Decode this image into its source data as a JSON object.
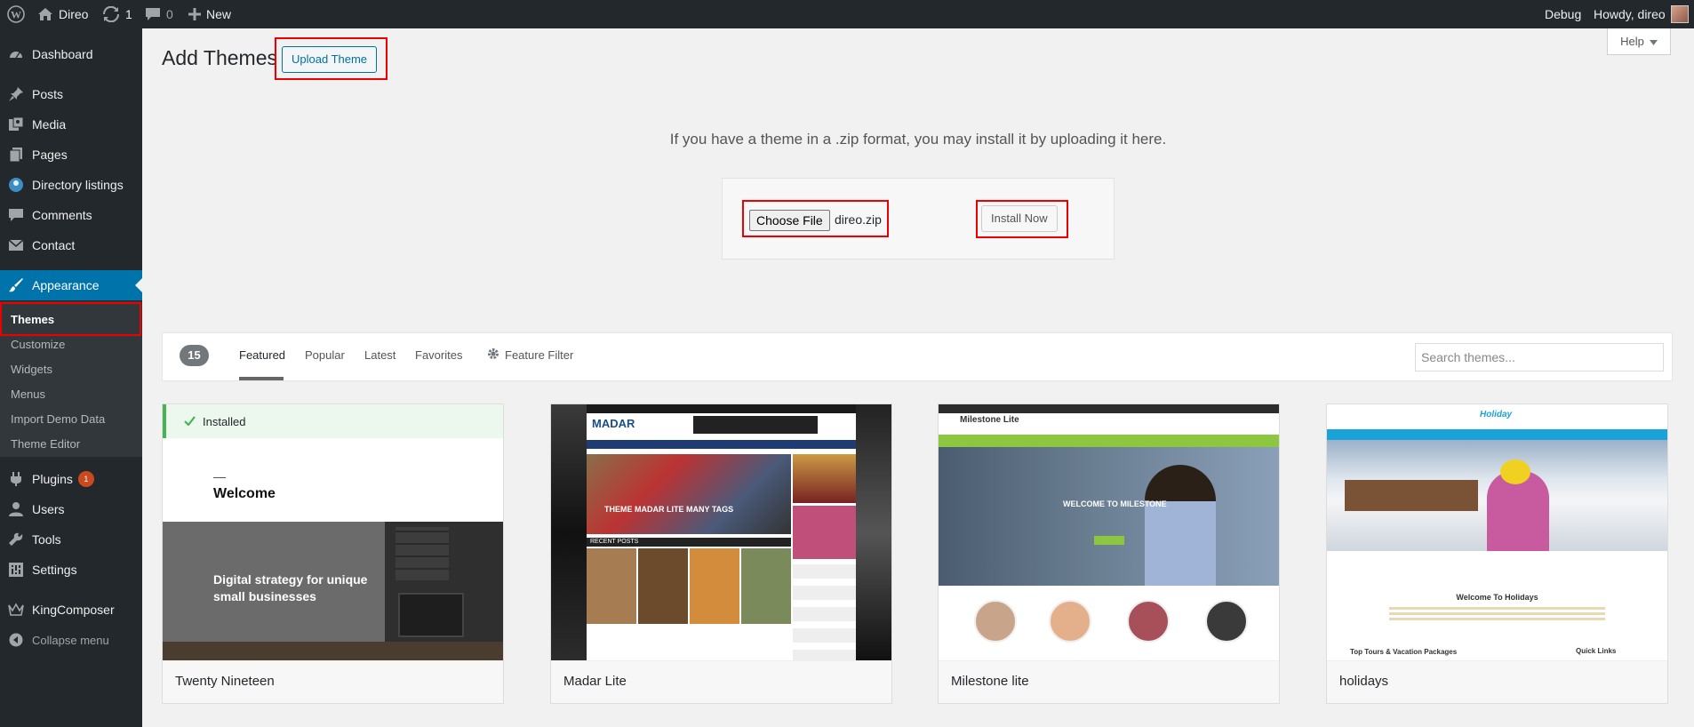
{
  "adminbar": {
    "site_name": "Direo",
    "updates_count": "1",
    "comments_count": "0",
    "new_label": "New",
    "debug_label": "Debug",
    "howdy_label": "Howdy, direo"
  },
  "sidebar": {
    "items": [
      {
        "label": "Dashboard",
        "icon": "dashboard-icon"
      },
      {
        "label": "Posts",
        "icon": "pin-icon"
      },
      {
        "label": "Media",
        "icon": "media-icon"
      },
      {
        "label": "Pages",
        "icon": "pages-icon"
      },
      {
        "label": "Directory listings",
        "icon": "directory-icon"
      },
      {
        "label": "Comments",
        "icon": "comments-icon"
      },
      {
        "label": "Contact",
        "icon": "mail-icon"
      },
      {
        "label": "Appearance",
        "icon": "brush-icon"
      },
      {
        "label": "Plugins",
        "icon": "plugin-icon",
        "badge": "1"
      },
      {
        "label": "Users",
        "icon": "user-icon"
      },
      {
        "label": "Tools",
        "icon": "wrench-icon"
      },
      {
        "label": "Settings",
        "icon": "settings-icon"
      },
      {
        "label": "KingComposer",
        "icon": "crown-icon"
      },
      {
        "label": "Collapse menu",
        "icon": "collapse-icon"
      }
    ],
    "appearance_sub": [
      "Themes",
      "Customize",
      "Widgets",
      "Menus",
      "Import Demo Data",
      "Theme Editor"
    ]
  },
  "header": {
    "title": "Add Themes",
    "upload_label": "Upload Theme",
    "help_label": "Help"
  },
  "upload": {
    "instructions": "If you have a theme in a .zip format, you may install it by uploading it here.",
    "choose_label": "Choose File",
    "file_name": "direo.zip",
    "install_label": "Install Now"
  },
  "filters": {
    "count": "15",
    "tabs": [
      "Featured",
      "Popular",
      "Latest",
      "Favorites"
    ],
    "feature_filter": "Feature Filter",
    "search_placeholder": "Search themes..."
  },
  "themes": [
    {
      "name": "Twenty Nineteen",
      "installed_label": "Installed",
      "preview_heading": "Welcome",
      "preview_tagline": "Digital strategy for unique small businesses"
    },
    {
      "name": "Madar Lite",
      "preview_headline": "THEME MADAR LITE MANY TAGS",
      "preview_section": "RECENT POSTS",
      "preview_logo": "MADAR"
    },
    {
      "name": "Milestone lite",
      "preview_logo": "Milestone Lite",
      "preview_banner": "WELCOME TO MILESTONE"
    },
    {
      "name": "holidays",
      "preview_logo": "Holiday",
      "preview_heading": "Welcome To Holidays",
      "preview_section": "Top Tours & Vacation Packages",
      "preview_side": "Quick Links"
    }
  ],
  "colors": {
    "admin_dark": "#23282d",
    "admin_blue": "#0073aa",
    "installed_green": "#46b450",
    "highlight_red": "#ee0000"
  }
}
